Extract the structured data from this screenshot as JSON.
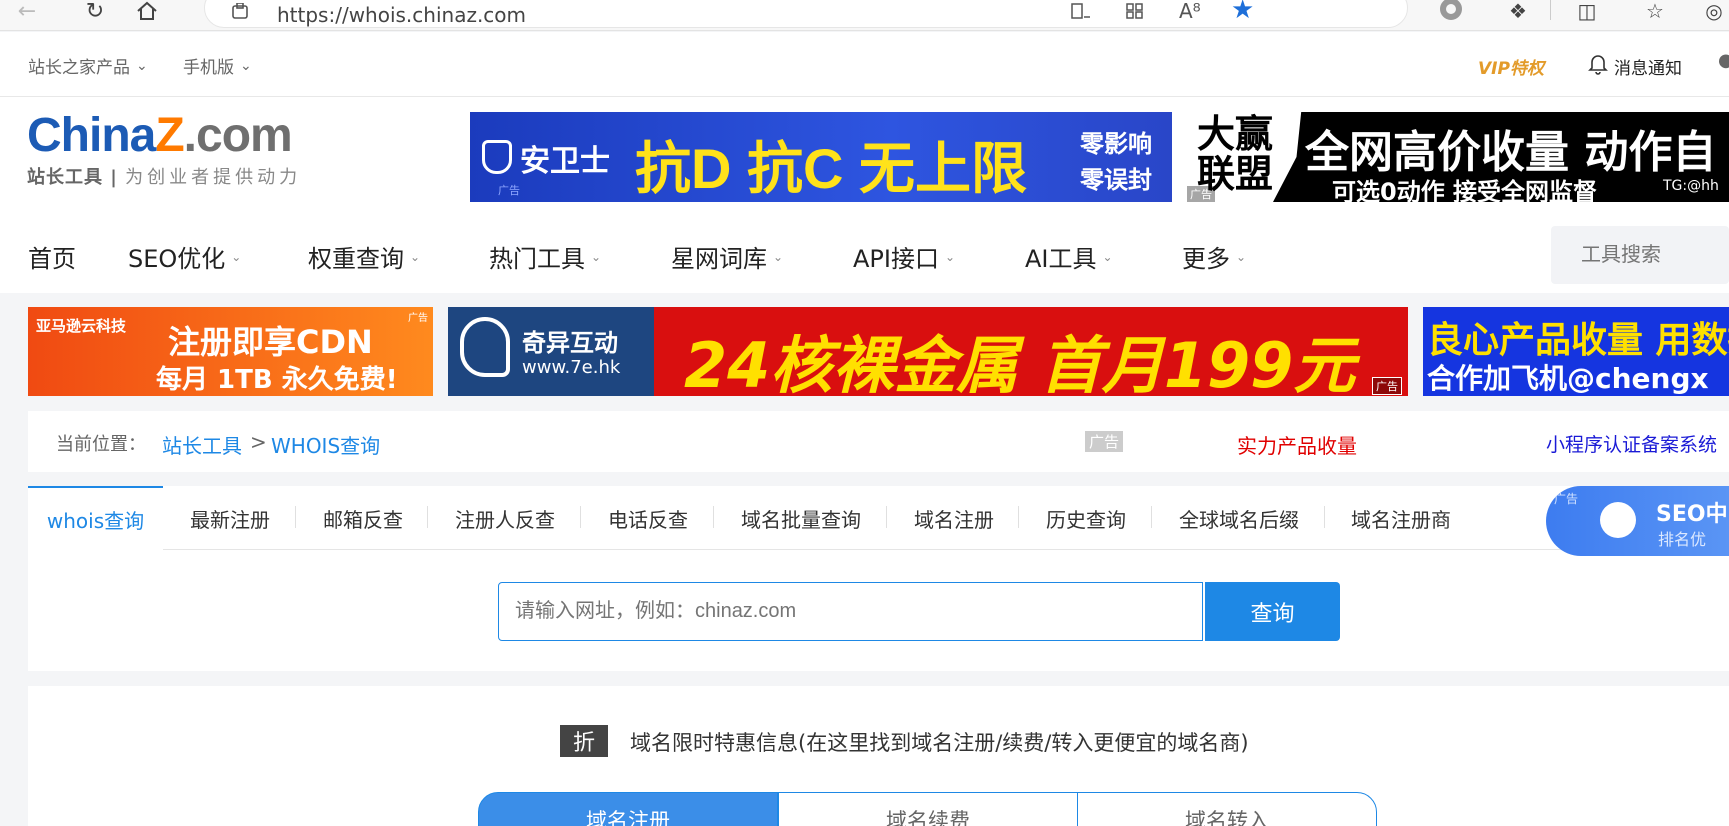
{
  "browser": {
    "url": "https://whois.chinaz.com",
    "icons": [
      "back-icon",
      "refresh-icon",
      "home-icon",
      "tracking-icon",
      "reading-view-icon",
      "apps-icon",
      "read-aloud-icon",
      "favorite-star-icon",
      "profile-icon",
      "extensions-icon",
      "split-screen-icon",
      "favorites-list-icon",
      "copilot-icon"
    ]
  },
  "topbar": {
    "products": "站长之家产品",
    "mobile": "手机版",
    "vip": "VIP特权",
    "notify": "消息通知"
  },
  "logo": {
    "main_a": "China",
    "main_z": "Z",
    "main_b": ".com",
    "sub_a": "站长工具",
    "sub_b": "为创业者提供动力"
  },
  "ads_top": {
    "left": {
      "brand": "安卫士",
      "slogan": "抗D 抗C 无上限",
      "note1": "零影响",
      "note2": "零误封",
      "label": "广告"
    },
    "right": {
      "brand1": "大赢",
      "brand2": "联盟",
      "line1": "全网高价收量  动作自",
      "line2": "可选0动作 接受全网监督",
      "tg": "TG:@hh",
      "label": "广告"
    }
  },
  "nav": {
    "items": [
      "首页",
      "SEO优化",
      "权重查询",
      "热门工具",
      "星网词库",
      "API接口",
      "AI工具",
      "更多"
    ],
    "search_placeholder": "工具搜索"
  },
  "ads_row": {
    "a1": {
      "tag": "亚马逊云科技",
      "line1": "注册即享CDN",
      "line2": "每月 1TB 永久免费!",
      "label": "广告"
    },
    "a2": {
      "brand": "奇异互动",
      "site": "www.7e.hk",
      "text": "24核裸金属  首月199元",
      "label": "广告"
    },
    "a3": {
      "line1": "良心产品收量 用数据",
      "line2": "合作加飞机@chengx"
    }
  },
  "breadcrumb": {
    "prefix": "当前位置：",
    "root": "站长工具",
    "sep": ">",
    "current": "WHOIS查询",
    "ad_label": "广告",
    "ad_link1": "实力产品收量",
    "ad_link2": "小程序认证备案系统"
  },
  "tabs": [
    "whois查询",
    "最新注册",
    "邮箱反查",
    "注册人反查",
    "电话反查",
    "域名批量查询",
    "域名注册",
    "历史查询",
    "全球域名后缀",
    "域名注册商"
  ],
  "side_ad": {
    "label": "广告",
    "title": "SEO中",
    "sub": "排名优"
  },
  "search": {
    "placeholder": "请输入网址，例如：chinaz.com",
    "button": "查询"
  },
  "promo": {
    "badge": "折",
    "text": "域名限时特惠信息(在这里找到域名注册/续费/转入更便宜的域名商)",
    "tabs": [
      "域名注册",
      "域名续费",
      "域名转入"
    ]
  },
  "colors": {
    "accent": "#1e88e5",
    "logo_blue": "#1c5bb5",
    "logo_orange": "#ff7a00",
    "ad_red": "#e00000",
    "ad_blue": "#1a1ad6"
  }
}
